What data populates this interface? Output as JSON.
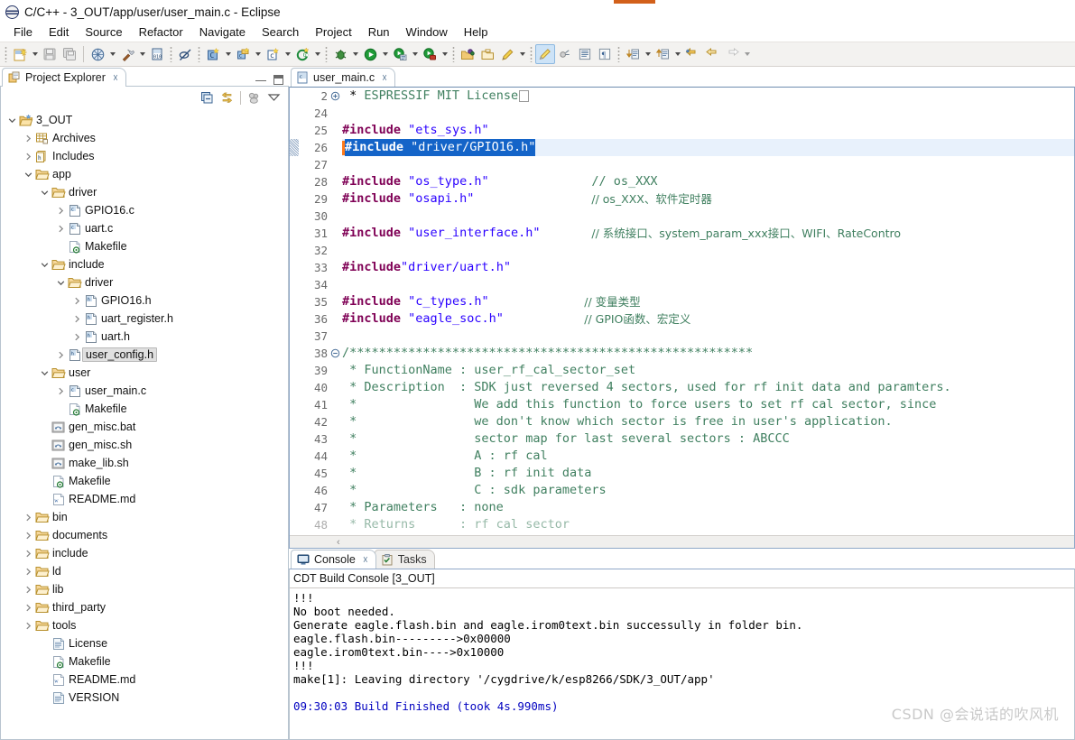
{
  "window": {
    "title": "C/C++ - 3_OUT/app/user/user_main.c - Eclipse",
    "app_icon": "eclipse-icon",
    "accent_color": "#d2601a"
  },
  "menubar": {
    "items": [
      {
        "label": "File"
      },
      {
        "label": "Edit"
      },
      {
        "label": "Source"
      },
      {
        "label": "Refactor"
      },
      {
        "label": "Navigate"
      },
      {
        "label": "Search"
      },
      {
        "label": "Project"
      },
      {
        "label": "Run"
      },
      {
        "label": "Window"
      },
      {
        "label": "Help"
      }
    ]
  },
  "toolbar": {
    "items": [
      {
        "icon": "new-file-icon",
        "dropdown": true
      },
      {
        "sep": true
      },
      {
        "icon": "save-icon",
        "dropdown": false
      },
      {
        "icon": "save-all-icon",
        "dropdown": false
      },
      {
        "divider": true
      },
      {
        "icon": "build-all-icon",
        "dropdown": true
      },
      {
        "icon": "hammer-build-icon",
        "dropdown": true
      },
      {
        "icon": "binary-icon",
        "dropdown": false
      },
      {
        "dots": true
      },
      {
        "icon": "skip-breakpoints-icon",
        "dropdown": false
      },
      {
        "dots": true
      },
      {
        "icon": "new-c-project-icon",
        "dropdown": true
      },
      {
        "icon": "new-cpp-project-icon",
        "dropdown": true
      },
      {
        "icon": "new-c-file-icon",
        "dropdown": true
      },
      {
        "icon": "new-class-icon",
        "dropdown": true
      },
      {
        "dots": true
      },
      {
        "icon": "debug-icon",
        "dropdown": true
      },
      {
        "icon": "run-icon",
        "dropdown": true
      },
      {
        "icon": "run-external-tools-icon",
        "dropdown": true
      },
      {
        "icon": "profile-icon",
        "dropdown": true
      },
      {
        "dots": true
      },
      {
        "icon": "open-element-icon",
        "dropdown": false
      },
      {
        "icon": "open-folder-icon",
        "dropdown": false
      },
      {
        "icon": "pencil-edit-icon",
        "dropdown": true
      },
      {
        "dots": true
      },
      {
        "icon": "toggle-mark-occurrences-icon",
        "active": true
      },
      {
        "icon": "toggle-block-selection-icon"
      },
      {
        "icon": "show-whitespace-icon"
      },
      {
        "icon": "pilcrow-icon"
      },
      {
        "dots": true
      },
      {
        "icon": "next-annotation-icon",
        "dropdown": true
      },
      {
        "icon": "prev-annotation-icon",
        "dropdown": true
      },
      {
        "icon": "last-edit-location-icon"
      },
      {
        "icon": "back-icon"
      },
      {
        "icon": "forward-icon",
        "dropdown": true
      }
    ]
  },
  "project_explorer": {
    "tab_label": "Project Explorer",
    "tab_icon": "project-explorer-icon",
    "close_icon": "close-icon",
    "minimize_icon": "minimize-icon",
    "maximize_icon": "maximize-icon",
    "toolbar_icons": [
      {
        "name": "collapse-all-icon"
      },
      {
        "name": "link-with-editor-icon"
      },
      {
        "name": "focus-on-active-task-icon"
      },
      {
        "name": "view-menu-icon"
      }
    ],
    "tree": [
      {
        "indent": 0,
        "twist": "open",
        "icon": "project-icon",
        "label": "3_OUT"
      },
      {
        "indent": 1,
        "twist": "closed",
        "icon": "archives-icon",
        "label": "Archives"
      },
      {
        "indent": 1,
        "twist": "closed",
        "icon": "includes-icon",
        "label": "Includes"
      },
      {
        "indent": 1,
        "twist": "open",
        "icon": "folder-icon",
        "label": "app"
      },
      {
        "indent": 2,
        "twist": "open",
        "icon": "folder-icon",
        "label": "driver"
      },
      {
        "indent": 3,
        "twist": "closed",
        "icon": "c-file-icon",
        "label": "GPIO16.c"
      },
      {
        "indent": 3,
        "twist": "closed",
        "icon": "c-file-icon",
        "label": "uart.c"
      },
      {
        "indent": 3,
        "twist": "none",
        "icon": "makefile-icon",
        "label": "Makefile"
      },
      {
        "indent": 2,
        "twist": "open",
        "icon": "folder-icon",
        "label": "include"
      },
      {
        "indent": 3,
        "twist": "open",
        "icon": "folder-icon",
        "label": "driver"
      },
      {
        "indent": 4,
        "twist": "closed",
        "icon": "h-file-icon",
        "label": "GPIO16.h"
      },
      {
        "indent": 4,
        "twist": "closed",
        "icon": "h-file-icon",
        "label": "uart_register.h"
      },
      {
        "indent": 4,
        "twist": "closed",
        "icon": "h-file-icon",
        "label": "uart.h"
      },
      {
        "indent": 3,
        "twist": "closed",
        "icon": "h-file-icon",
        "label": "user_config.h",
        "selected": true
      },
      {
        "indent": 2,
        "twist": "open",
        "icon": "folder-icon",
        "label": "user"
      },
      {
        "indent": 3,
        "twist": "closed",
        "icon": "c-file-icon",
        "label": "user_main.c"
      },
      {
        "indent": 3,
        "twist": "none",
        "icon": "makefile-icon",
        "label": "Makefile"
      },
      {
        "indent": 2,
        "twist": "none",
        "icon": "script-icon",
        "label": "gen_misc.bat"
      },
      {
        "indent": 2,
        "twist": "none",
        "icon": "script-icon",
        "label": "gen_misc.sh"
      },
      {
        "indent": 2,
        "twist": "none",
        "icon": "script-icon",
        "label": "make_lib.sh"
      },
      {
        "indent": 2,
        "twist": "none",
        "icon": "makefile-icon",
        "label": "Makefile"
      },
      {
        "indent": 2,
        "twist": "none",
        "icon": "markdown-icon",
        "label": "README.md"
      },
      {
        "indent": 1,
        "twist": "closed",
        "icon": "folder-icon",
        "label": "bin"
      },
      {
        "indent": 1,
        "twist": "closed",
        "icon": "folder-icon",
        "label": "documents"
      },
      {
        "indent": 1,
        "twist": "closed",
        "icon": "folder-icon",
        "label": "include"
      },
      {
        "indent": 1,
        "twist": "closed",
        "icon": "folder-icon",
        "label": "ld"
      },
      {
        "indent": 1,
        "twist": "closed",
        "icon": "folder-icon",
        "label": "lib"
      },
      {
        "indent": 1,
        "twist": "closed",
        "icon": "folder-icon",
        "label": "third_party"
      },
      {
        "indent": 1,
        "twist": "closed",
        "icon": "folder-icon",
        "label": "tools"
      },
      {
        "indent": 2,
        "twist": "none",
        "icon": "text-file-icon",
        "label": "License"
      },
      {
        "indent": 2,
        "twist": "none",
        "icon": "makefile-icon",
        "label": "Makefile"
      },
      {
        "indent": 2,
        "twist": "none",
        "icon": "markdown-icon",
        "label": "README.md"
      },
      {
        "indent": 2,
        "twist": "none",
        "icon": "text-file-icon",
        "label": "VERSION"
      }
    ]
  },
  "editor": {
    "tab_label": "user_main.c",
    "tab_icon": "c-file-icon",
    "close_icon": "close-icon",
    "selection_color": "#1464c8",
    "current_line_color": "#e8f1fc",
    "caret_color": "#ff7a1a",
    "lines": [
      {
        "num": "2",
        "fold": "collapsed",
        "tokens": [
          {
            "t": "plain",
            "v": " * "
          },
          {
            "t": "cmt",
            "v": "ESPRESSIF MIT License"
          },
          {
            "t": "foldbox",
            "v": ""
          }
        ]
      },
      {
        "num": "24",
        "fold": "",
        "tokens": []
      },
      {
        "num": "25",
        "fold": "",
        "tokens": [
          {
            "t": "kw",
            "v": "#include"
          },
          {
            "t": "plain",
            "v": " "
          },
          {
            "t": "str",
            "v": "\"ets_sys.h\""
          }
        ]
      },
      {
        "num": "26",
        "fold": "",
        "highlight": true,
        "changebar": true,
        "caret": true,
        "tokens": [
          {
            "t": "sel-kw",
            "v": "#include"
          },
          {
            "t": "sel",
            "v": " "
          },
          {
            "t": "sel",
            "v": "\"driver/GPIO16.h\""
          }
        ]
      },
      {
        "num": "27",
        "fold": "",
        "tokens": []
      },
      {
        "num": "28",
        "fold": "",
        "tokens": [
          {
            "t": "kw",
            "v": "#include"
          },
          {
            "t": "plain",
            "v": " "
          },
          {
            "t": "str",
            "v": "\"os_type.h\""
          },
          {
            "t": "pad",
            "v": "              "
          },
          {
            "t": "cmt",
            "v": "// os_XXX"
          }
        ]
      },
      {
        "num": "29",
        "fold": "",
        "tokens": [
          {
            "t": "kw",
            "v": "#include"
          },
          {
            "t": "plain",
            "v": " "
          },
          {
            "t": "str",
            "v": "\"osapi.h\""
          },
          {
            "t": "pad",
            "v": "                "
          },
          {
            "t": "cmt",
            "v": "// os_XXX、软件定时器"
          }
        ]
      },
      {
        "num": "30",
        "fold": "",
        "tokens": []
      },
      {
        "num": "31",
        "fold": "",
        "tokens": [
          {
            "t": "kw",
            "v": "#include"
          },
          {
            "t": "plain",
            "v": " "
          },
          {
            "t": "str",
            "v": "\"user_interface.h\""
          },
          {
            "t": "pad",
            "v": "       "
          },
          {
            "t": "cmt",
            "v": "// 系统接口、system_param_xxx接口、WIFI、RateContro"
          }
        ]
      },
      {
        "num": "32",
        "fold": "",
        "tokens": []
      },
      {
        "num": "33",
        "fold": "",
        "tokens": [
          {
            "t": "kw",
            "v": "#include"
          },
          {
            "t": "str",
            "v": "\"driver/uart.h\""
          }
        ]
      },
      {
        "num": "34",
        "fold": "",
        "tokens": []
      },
      {
        "num": "35",
        "fold": "",
        "tokens": [
          {
            "t": "kw",
            "v": "#include"
          },
          {
            "t": "plain",
            "v": " "
          },
          {
            "t": "str",
            "v": "\"c_types.h\""
          },
          {
            "t": "pad",
            "v": "             "
          },
          {
            "t": "cmt",
            "v": "// 变量类型"
          }
        ]
      },
      {
        "num": "36",
        "fold": "",
        "tokens": [
          {
            "t": "kw",
            "v": "#include"
          },
          {
            "t": "plain",
            "v": " "
          },
          {
            "t": "str",
            "v": "\"eagle_soc.h\""
          },
          {
            "t": "pad",
            "v": "           "
          },
          {
            "t": "cmt",
            "v": "// GPIO函数、宏定义"
          }
        ]
      },
      {
        "num": "37",
        "fold": "",
        "tokens": []
      },
      {
        "num": "38",
        "fold": "expanded",
        "tokens": [
          {
            "t": "cmt",
            "v": "/*******************************************************"
          }
        ]
      },
      {
        "num": "39",
        "fold": "",
        "tokens": [
          {
            "t": "cmt",
            "v": " * FunctionName : user_rf_cal_sector_set"
          }
        ]
      },
      {
        "num": "40",
        "fold": "",
        "tokens": [
          {
            "t": "cmt",
            "v": " * Description  : SDK just reversed 4 sectors, used for rf init data and paramters."
          }
        ]
      },
      {
        "num": "41",
        "fold": "",
        "tokens": [
          {
            "t": "cmt",
            "v": " *                We add this function to force users to set rf cal sector, since"
          }
        ]
      },
      {
        "num": "42",
        "fold": "",
        "tokens": [
          {
            "t": "cmt",
            "v": " *                we don't know which sector is free in user's application."
          }
        ]
      },
      {
        "num": "43",
        "fold": "",
        "tokens": [
          {
            "t": "cmt",
            "v": " *                sector map for last several sectors : ABCCC"
          }
        ]
      },
      {
        "num": "44",
        "fold": "",
        "tokens": [
          {
            "t": "cmt",
            "v": " *                A : rf cal"
          }
        ]
      },
      {
        "num": "45",
        "fold": "",
        "tokens": [
          {
            "t": "cmt",
            "v": " *                B : rf init data"
          }
        ]
      },
      {
        "num": "46",
        "fold": "",
        "tokens": [
          {
            "t": "cmt",
            "v": " *                C : sdk parameters"
          }
        ]
      },
      {
        "num": "47",
        "fold": "",
        "tokens": [
          {
            "t": "cmt",
            "v": " * Parameters   : none"
          }
        ]
      },
      {
        "num": "48",
        "fold": "",
        "clipped": true,
        "tokens": [
          {
            "t": "cmt",
            "v": " * Returns      : rf cal sector"
          }
        ]
      }
    ]
  },
  "console": {
    "tabs": [
      {
        "label": "Console",
        "icon": "console-icon",
        "active": true,
        "close_icon": "close-icon"
      },
      {
        "label": "Tasks",
        "icon": "tasks-icon",
        "active": false
      }
    ],
    "title": "CDT Build Console [3_OUT]",
    "output": [
      {
        "text": "!!!",
        "blue": false
      },
      {
        "text": "No boot needed.",
        "blue": false
      },
      {
        "text": "Generate eagle.flash.bin and eagle.irom0text.bin successully in folder bin.",
        "blue": false
      },
      {
        "text": "eagle.flash.bin--------->0x00000",
        "blue": false
      },
      {
        "text": "eagle.irom0text.bin---->0x10000",
        "blue": false
      },
      {
        "text": "!!!",
        "blue": false
      },
      {
        "text": "make[1]: Leaving directory '/cygdrive/k/esp8266/SDK/3_OUT/app'",
        "blue": false
      },
      {
        "text": "",
        "blue": false
      },
      {
        "text": "09:30:03 Build Finished (took 4s.990ms)",
        "blue": true
      }
    ]
  },
  "watermark": {
    "text": "CSDN @会说话的吹风机"
  }
}
